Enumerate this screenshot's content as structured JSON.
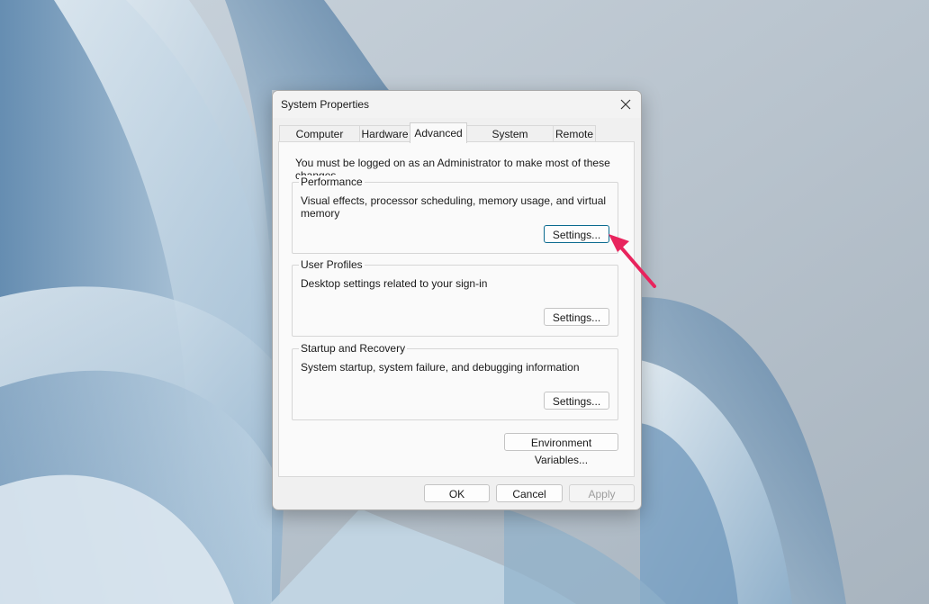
{
  "dialog": {
    "title": "System Properties",
    "tabs": [
      {
        "label": "Computer Name"
      },
      {
        "label": "Hardware"
      },
      {
        "label": "Advanced"
      },
      {
        "label": "System Protection"
      },
      {
        "label": "Remote"
      }
    ],
    "active_tab": "Advanced",
    "notice": "You must be logged on as an Administrator to make most of these changes.",
    "groups": [
      {
        "label": "Performance",
        "description": "Visual effects, processor scheduling, memory usage, and virtual memory",
        "button": "Settings..."
      },
      {
        "label": "User Profiles",
        "description": "Desktop settings related to your sign-in",
        "button": "Settings..."
      },
      {
        "label": "Startup and Recovery",
        "description": "System startup, system failure, and debugging information",
        "button": "Settings..."
      }
    ],
    "environment_button": "Environment Variables...",
    "footer": {
      "ok": "OK",
      "cancel": "Cancel",
      "apply": "Apply"
    }
  },
  "colors": {
    "accent_focus": "#0b6a8f",
    "annotation_arrow": "#e8245d"
  },
  "icons": {
    "close": "close-icon",
    "annotation": "arrow-pointer"
  }
}
